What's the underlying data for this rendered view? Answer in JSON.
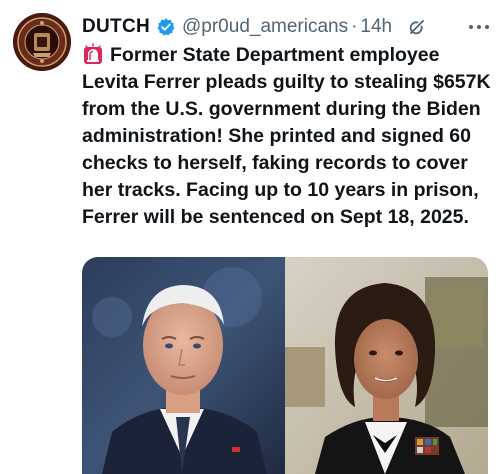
{
  "tweet": {
    "display_name": "DUTCH",
    "handle": "@pr0ud_americans",
    "separator": "·",
    "time": "14h",
    "text": "Former State Department employee Levita Ferrer pleads guilty to stealing $657K from the U.S. government during the Biden administration! She printed and signed 60 checks to herself, faking records to cover her tracks. Facing up to 10 years in prison, Ferrer will be sentenced on Sept 18, 2025.",
    "leading_emoji": "siren-icon"
  },
  "icons": {
    "verified": "verified-badge-icon",
    "grok": "grok-icon",
    "more": "more-options-icon"
  },
  "colors": {
    "verified_blue": "#1d9bf0",
    "text": "#0f1419",
    "secondary": "#536471",
    "siren_red": "#e0245e"
  }
}
